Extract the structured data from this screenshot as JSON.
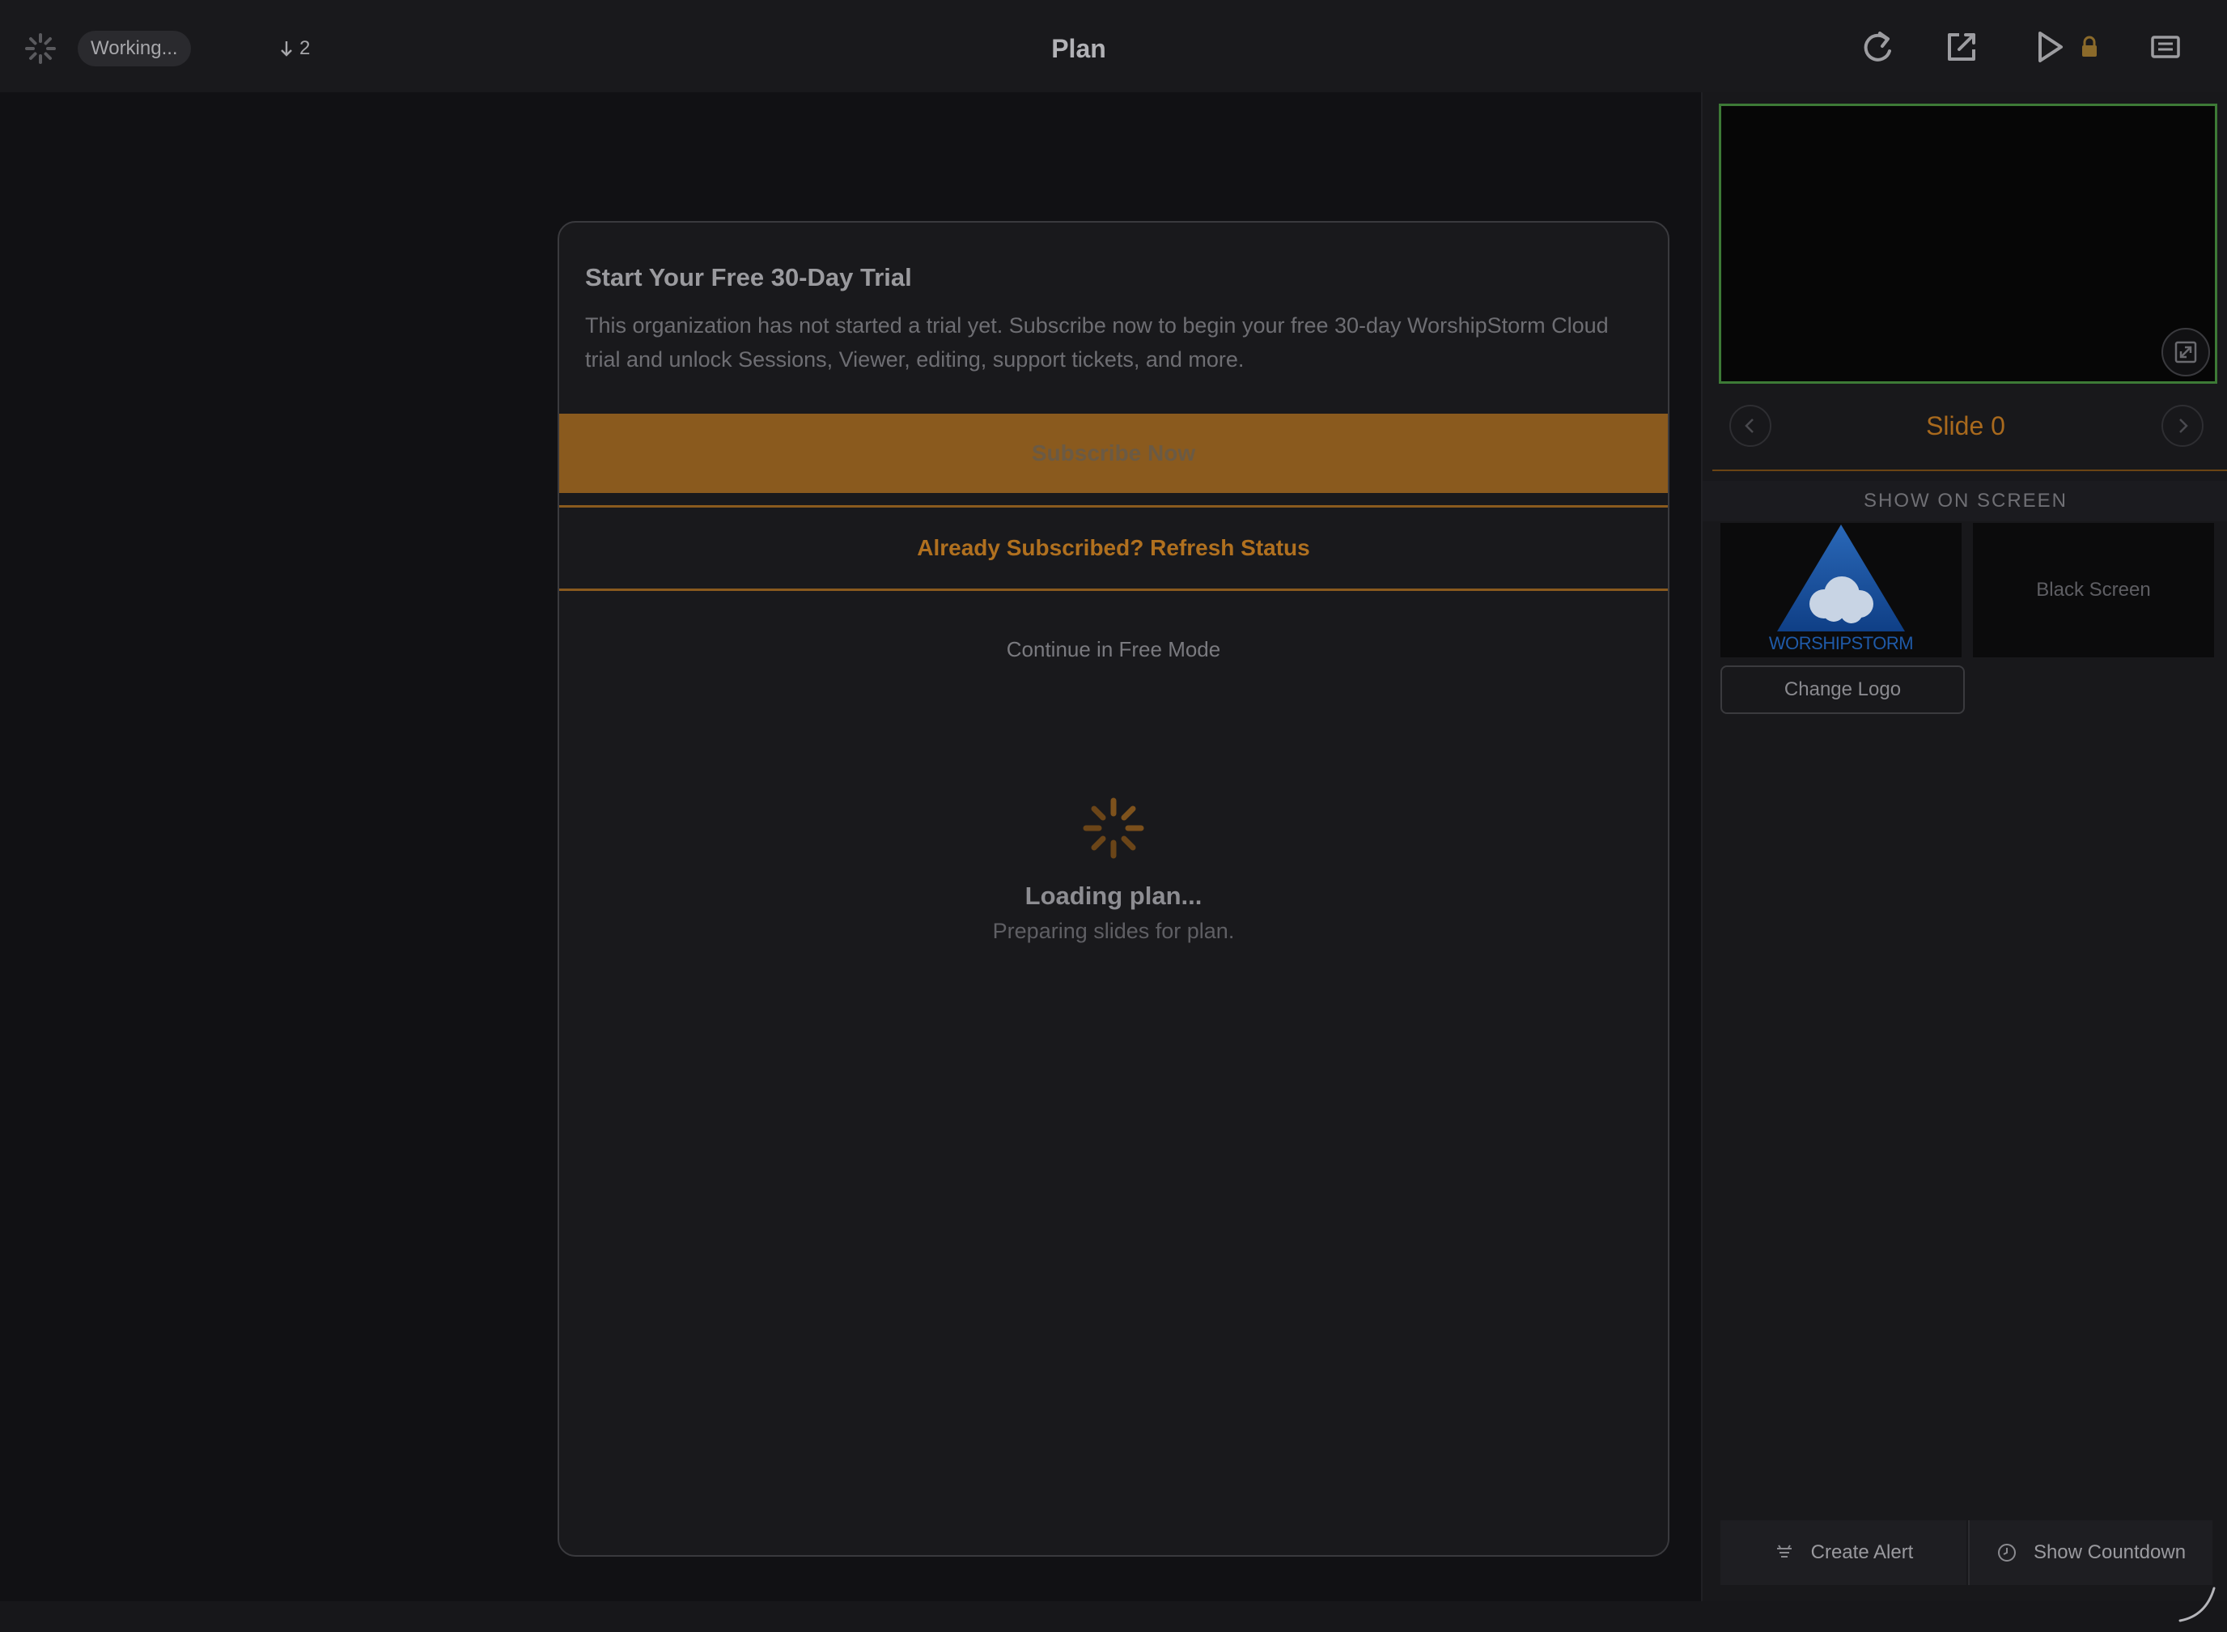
{
  "topbar": {
    "status_label": "Working...",
    "pending_count": "2",
    "title": "Plan",
    "icons": [
      "spinner-icon",
      "down-arrow-icon",
      "refresh-icon",
      "open-external-icon",
      "play-icon",
      "lock-icon",
      "screen-icon"
    ]
  },
  "trial": {
    "title": "Start Your Free 30-Day Trial",
    "description": "This organization has not started a trial yet. Subscribe now to begin your free 30-day WorshipStorm Cloud trial and unlock Sessions, Viewer, editing, support tickets, and more.",
    "subscribe_label": "Subscribe Now",
    "refresh_label": "Already Subscribed? Refresh Status",
    "free_mode_label": "Continue in Free Mode"
  },
  "loading": {
    "title": "Loading plan...",
    "subtitle": "Preparing slides for plan."
  },
  "panel": {
    "slide_label": "Slide 0",
    "section_heading": "SHOW ON SCREEN",
    "logo_tile_text": "WORSHIPSTORM",
    "black_tile_label": "Black Screen",
    "change_logo_label": "Change Logo",
    "create_alert_label": "Create Alert",
    "show_countdown_label": "Show Countdown"
  },
  "colors": {
    "accent": "#b0701f",
    "subscribe_bg": "#8a5a1e",
    "preview_border": "#3d7a36",
    "background": "#111114"
  }
}
